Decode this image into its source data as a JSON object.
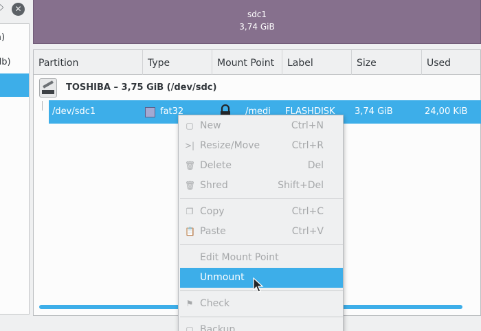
{
  "sidebar": {
    "items": [
      "a)",
      "db)",
      ""
    ]
  },
  "graphic": {
    "name": "sdc1",
    "size": "3,74 GiB"
  },
  "table": {
    "headers": [
      "Partition",
      "Type",
      "Mount Point",
      "Label",
      "Size",
      "Used"
    ],
    "device": "TOSHIBA  – 3,75 GiB (/dev/sdc)",
    "row": {
      "partition": "/dev/sdc1",
      "type": "fat32",
      "mount_point": "/medi",
      "label": "FLASHDISK",
      "size": "3,74 GiB",
      "used": "24,00 KiB"
    }
  },
  "menu": {
    "items": [
      {
        "label": "New",
        "shortcut": "Ctrl+N",
        "icon": "new-icon",
        "glyph": "▢"
      },
      {
        "label": "Resize/Move",
        "shortcut": "Ctrl+R",
        "icon": "resize-icon",
        "glyph": ">|"
      },
      {
        "label": "Delete",
        "shortcut": "Del",
        "icon": "delete-icon",
        "glyph": "🗑"
      },
      {
        "label": "Shred",
        "shortcut": "Shift+Del",
        "icon": "shred-icon",
        "glyph": "🗑"
      },
      {
        "label": "Copy",
        "shortcut": "Ctrl+C",
        "icon": "copy-icon",
        "glyph": "❐"
      },
      {
        "label": "Paste",
        "shortcut": "Ctrl+V",
        "icon": "paste-icon",
        "glyph": "📋"
      },
      {
        "label": "Edit Mount Point",
        "shortcut": "",
        "icon": "",
        "glyph": ""
      },
      {
        "label": "Unmount",
        "shortcut": "",
        "icon": "",
        "glyph": ""
      },
      {
        "label": "Check",
        "shortcut": "",
        "icon": "flag-icon",
        "glyph": "⚑"
      },
      {
        "label": "Backup",
        "shortcut": "",
        "icon": "backup-icon",
        "glyph": "▢"
      }
    ]
  },
  "colors": {
    "accent": "#3daee9",
    "partition_graphic": "#86708d",
    "fat32_swatch": "#a3a9d2"
  }
}
